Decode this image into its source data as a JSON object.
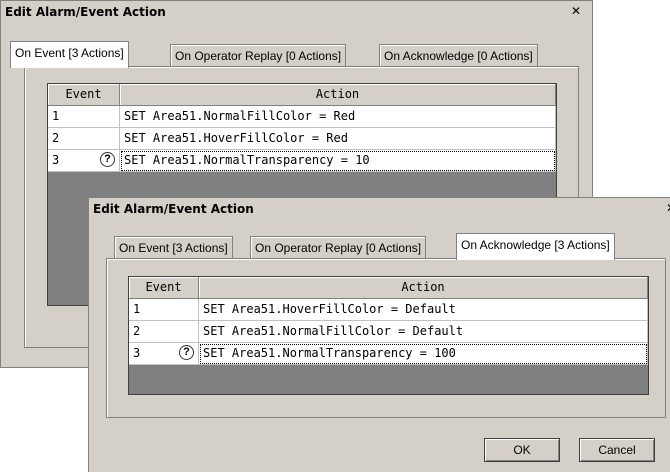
{
  "dialog_back": {
    "title": "Edit Alarm/Event Action",
    "close": "✕",
    "tabs": [
      "On Event [3 Actions]",
      "On Operator Replay [0 Actions]",
      "On Acknowledge [0 Actions]"
    ],
    "active_tab": 0,
    "columns": [
      "Event",
      "Action"
    ],
    "rows": [
      {
        "event": "1",
        "action": "SET Area51.NormalFillColor = Red"
      },
      {
        "event": "2",
        "action": "SET Area51.HoverFillColor = Red"
      },
      {
        "event": "3",
        "action": "SET Area51.NormalTransparency = 10",
        "icon": "question-icon",
        "selected": true
      }
    ]
  },
  "dialog_front": {
    "title": "Edit Alarm/Event Action",
    "close": "✕",
    "tabs": [
      "On Event [3 Actions]",
      "On Operator Replay [0 Actions]",
      "On Acknowledge [3 Actions]"
    ],
    "active_tab": 2,
    "columns": [
      "Event",
      "Action"
    ],
    "rows": [
      {
        "event": "1",
        "action": "SET Area51.HoverFillColor = Default"
      },
      {
        "event": "2",
        "action": "SET Area51.NormalFillColor = Default"
      },
      {
        "event": "3",
        "action": "SET Area51.NormalTransparency = 100",
        "icon": "question-icon",
        "selected": true
      }
    ],
    "buttons": {
      "ok": "OK",
      "cancel": "Cancel"
    }
  },
  "colors": {
    "dialog_bg": "#d4d0c8",
    "grid_empty": "#808080",
    "cell_bg": "#ffffff"
  }
}
